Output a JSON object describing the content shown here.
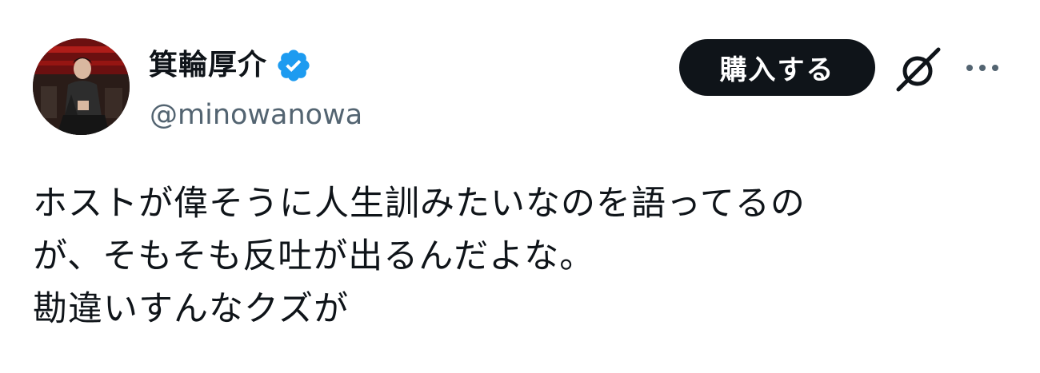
{
  "author": {
    "display_name": "箕輪厚介",
    "handle": "@minowanowa",
    "verified": true,
    "verified_color": "#1d9bf0"
  },
  "actions": {
    "buy_label": "購入する",
    "grok_icon": "grok-icon",
    "more_icon": "more-icon"
  },
  "tweet": {
    "lines": [
      "ホストが偉そうに人生訓みたいなのを語ってるの",
      "が、そもそも反吐が出るんだよな。",
      "勘違いすんなクズが"
    ]
  },
  "colors": {
    "text": "#0f1419",
    "secondary": "#536471",
    "button_bg": "#0f1419",
    "button_text": "#ffffff"
  }
}
